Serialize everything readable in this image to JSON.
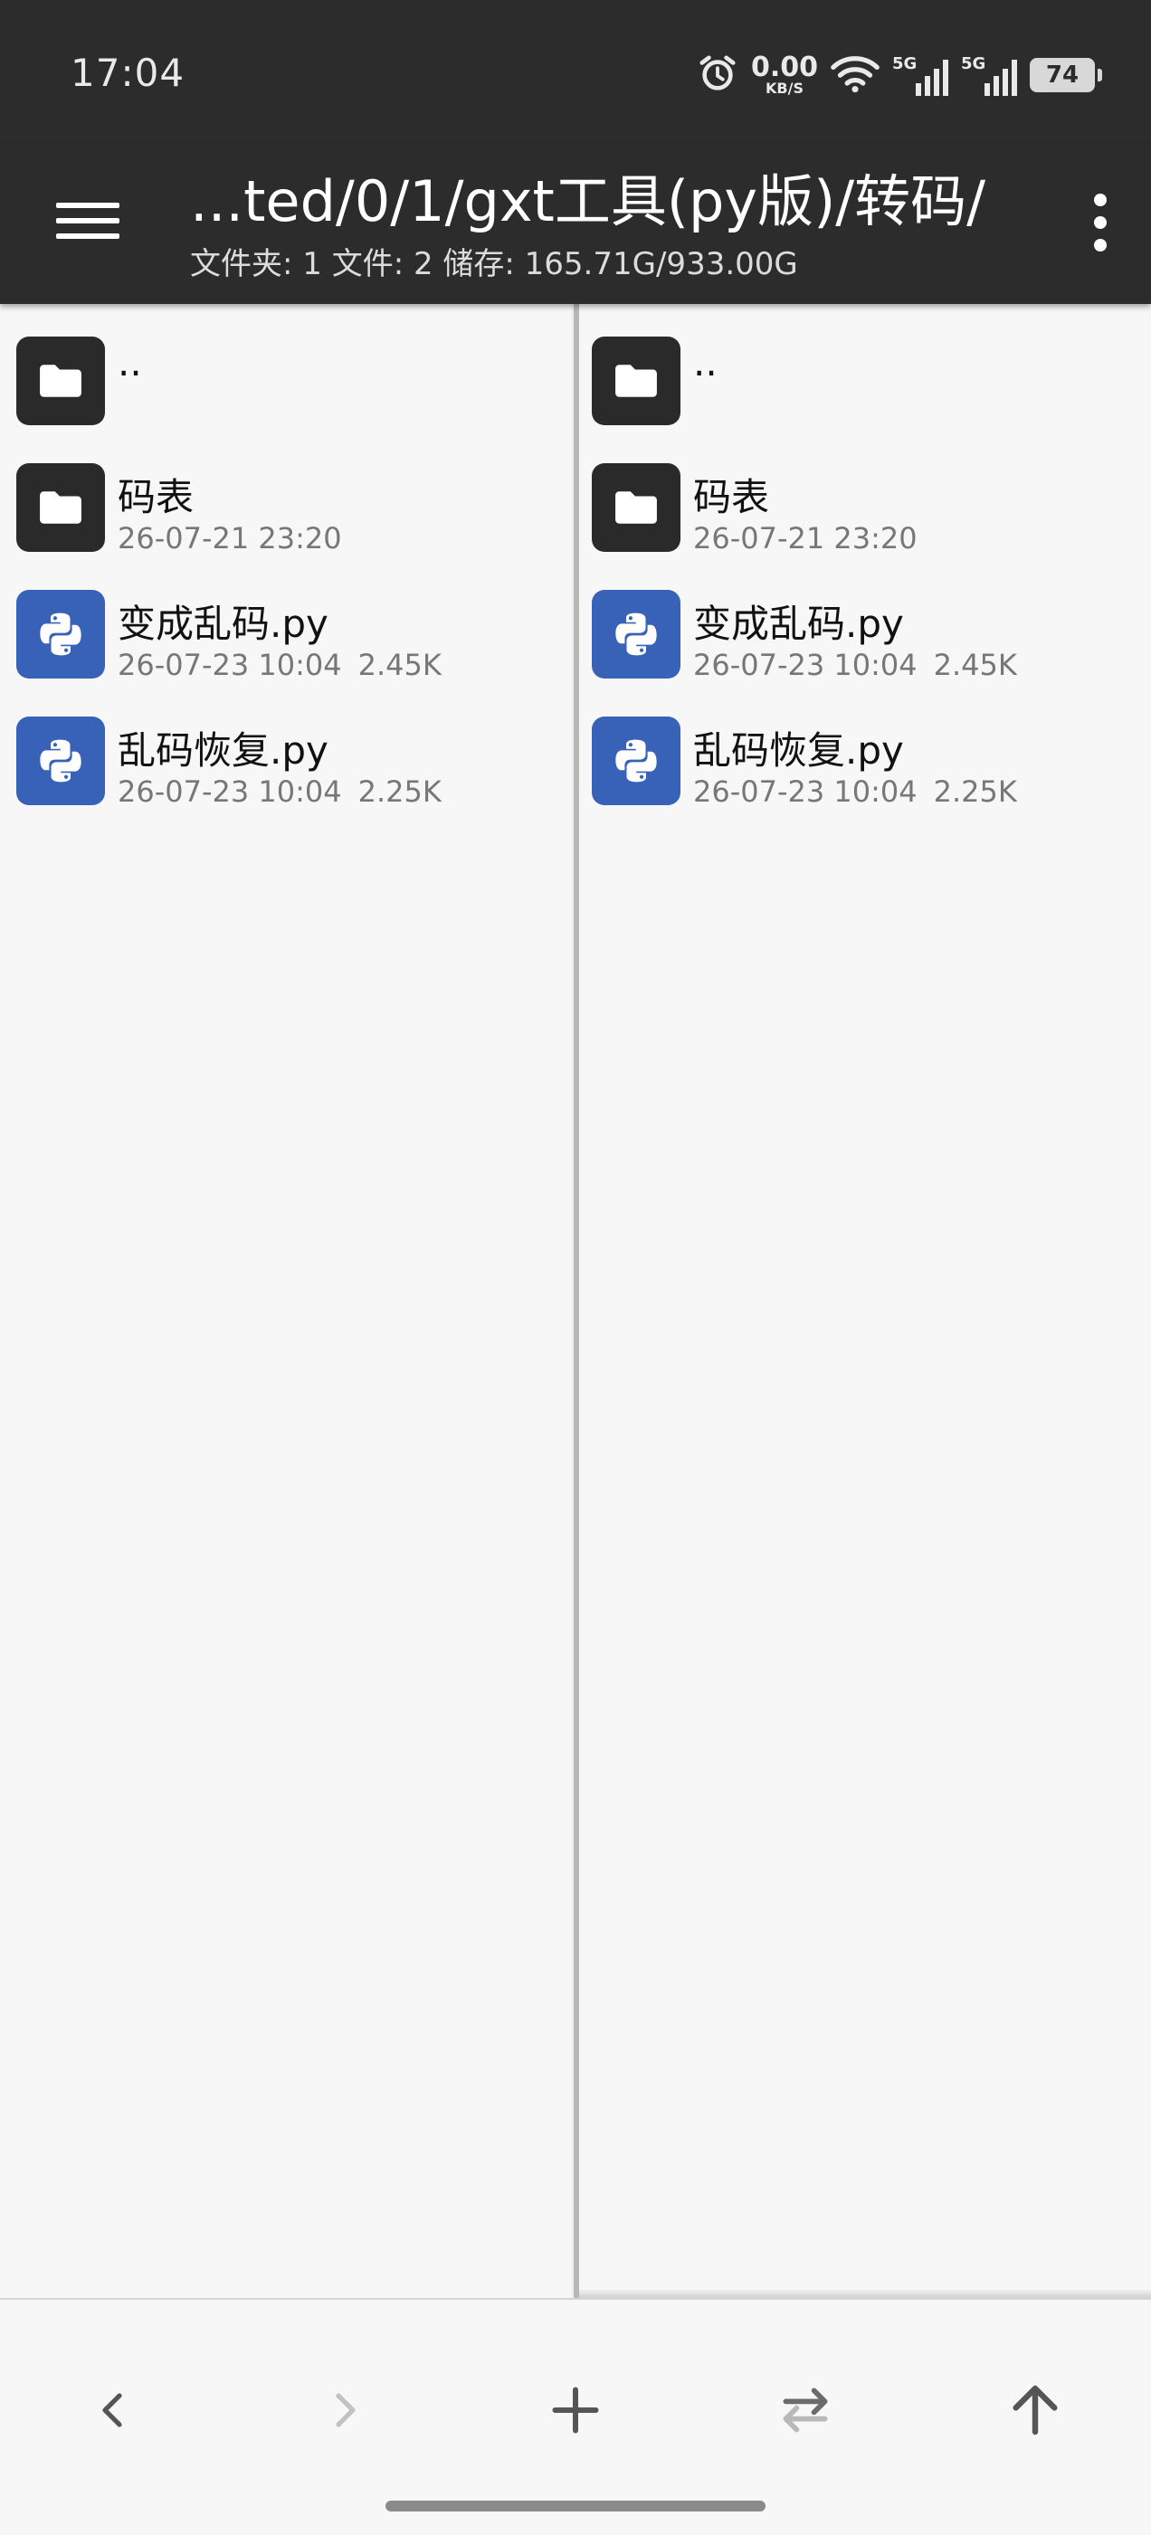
{
  "status_bar": {
    "time": "17:04",
    "net_speed": "0.00",
    "net_unit": "KB/S",
    "sim1_label": "5G",
    "sim2_label": "5G",
    "battery": "74",
    "icons": [
      "alarm-icon",
      "wifi-icon",
      "signal-icon",
      "battery-icon"
    ]
  },
  "app_bar": {
    "path": "...ted/0/1/gxt工具(py版)/转码/",
    "stats": "文件夹: 1  文件: 2  储存: 165.71G/933.00G"
  },
  "left_pane": {
    "items": [
      {
        "icon": "folder-icon",
        "name": "..",
        "date": "",
        "size": ""
      },
      {
        "icon": "folder-icon",
        "name": "码表",
        "date": "26-07-21 23:20",
        "size": ""
      },
      {
        "icon": "python-file-icon",
        "name": "变成乱码.py",
        "date": "26-07-23 10:04",
        "size": "2.45K"
      },
      {
        "icon": "python-file-icon",
        "name": "乱码恢复.py",
        "date": "26-07-23 10:04",
        "size": "2.25K"
      }
    ]
  },
  "right_pane": {
    "items": [
      {
        "icon": "folder-icon",
        "name": "..",
        "date": "",
        "size": ""
      },
      {
        "icon": "folder-icon",
        "name": "码表",
        "date": "26-07-21 23:20",
        "size": ""
      },
      {
        "icon": "python-file-icon",
        "name": "变成乱码.py",
        "date": "26-07-23 10:04",
        "size": "2.45K"
      },
      {
        "icon": "python-file-icon",
        "name": "乱码恢复.py",
        "date": "26-07-23 10:04",
        "size": "2.25K"
      }
    ]
  },
  "toolbar": {
    "buttons": [
      "back-icon",
      "forward-icon",
      "add-icon",
      "swap-panes-icon",
      "up-directory-icon"
    ]
  },
  "colors": {
    "bar_bg": "#2c2c2c",
    "folder_bg": "#2a2a2a",
    "python_bg": "#3862b8",
    "pane_bg": "#f7f7f7"
  }
}
